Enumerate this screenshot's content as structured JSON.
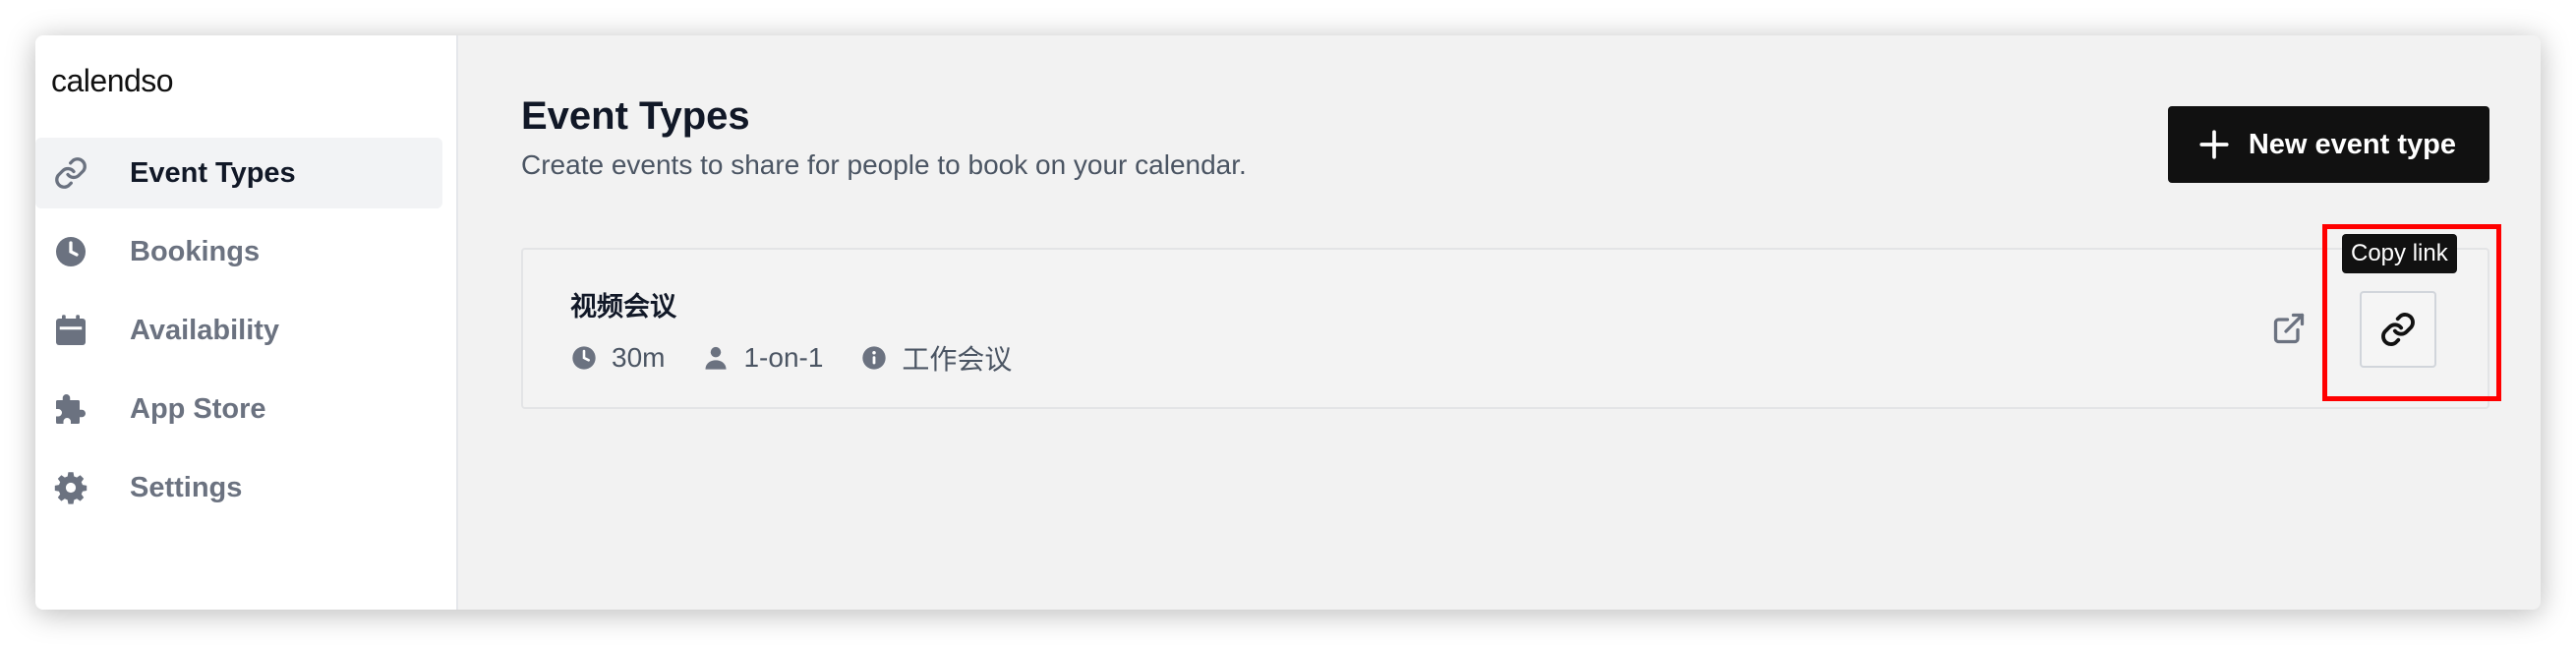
{
  "app": {
    "logo": "calendso"
  },
  "sidebar": {
    "items": [
      {
        "label": "Event Types",
        "icon": "link-icon",
        "active": true
      },
      {
        "label": "Bookings",
        "icon": "clock-icon",
        "active": false
      },
      {
        "label": "Availability",
        "icon": "calendar-icon",
        "active": false
      },
      {
        "label": "App Store",
        "icon": "puzzle-icon",
        "active": false
      },
      {
        "label": "Settings",
        "icon": "gear-icon",
        "active": false
      }
    ]
  },
  "main": {
    "title": "Event Types",
    "subtitle": "Create events to share for people to book on your calendar.",
    "new_button_label": "New event type"
  },
  "event": {
    "title": "视频会议",
    "duration": "30m",
    "type": "1-on-1",
    "description": "工作会议",
    "tooltip": "Copy link"
  },
  "colors": {
    "accent": "#111111",
    "highlight": "#ff0000",
    "muted_text": "#6b7280"
  }
}
